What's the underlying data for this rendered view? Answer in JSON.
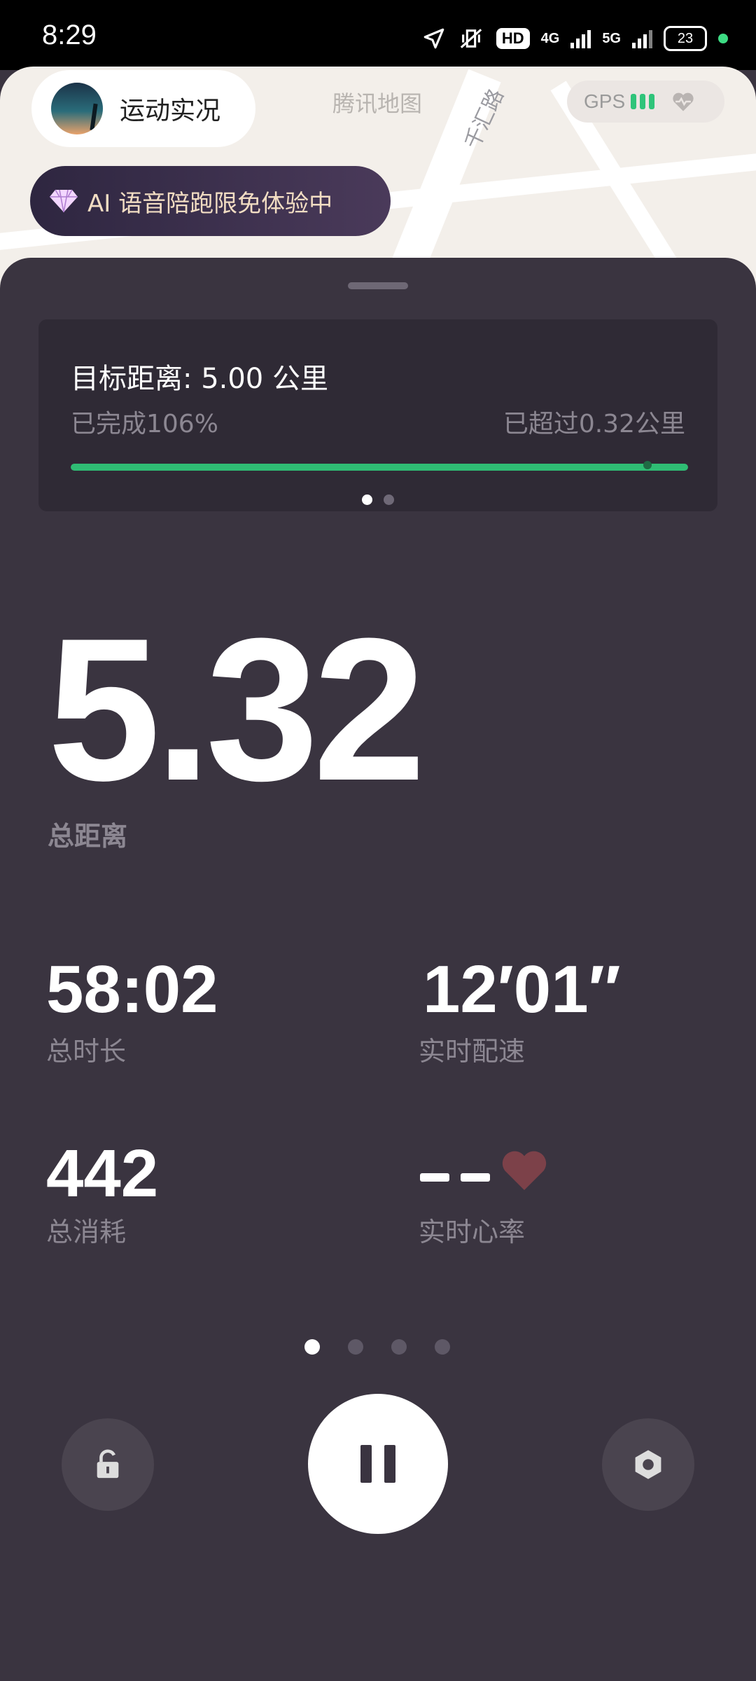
{
  "status_bar": {
    "time": "8:29",
    "hd_badge": "HD",
    "net1": "4G",
    "net2": "5G",
    "battery": "23"
  },
  "map": {
    "provider_label": "腾讯地图",
    "road_label": "千汇路"
  },
  "header": {
    "title": "运动实况",
    "gps_label": "GPS",
    "ai_banner": "AI 语音陪跑限免体验中"
  },
  "goal": {
    "title": "目标距离: 5.00 公里",
    "completed": "已完成106%",
    "exceeded": "已超过0.32公里",
    "progress_percent": 100,
    "page_count": 2,
    "active_page": 0
  },
  "main": {
    "distance_value": "5.32",
    "distance_label": "总距离"
  },
  "stats": {
    "duration_value": "58:02",
    "duration_label": "总时长",
    "pace_value": "12′01″",
    "pace_label": "实时配速",
    "calories_value": "442",
    "calories_label": "总消耗",
    "heart_rate_value": "--",
    "heart_rate_label": "实时心率"
  },
  "pager": {
    "count": 4,
    "active": 0
  },
  "colors": {
    "sheet_bg": "#3a3440",
    "progress": "#2fbd74",
    "heart": "#7c4149",
    "gps_bars": "#2fc47a",
    "banner_text": "#f2ddc3"
  },
  "icons": {
    "lock": "unlock-icon",
    "pause": "pause-icon",
    "settings": "hexagon-settings-icon"
  }
}
